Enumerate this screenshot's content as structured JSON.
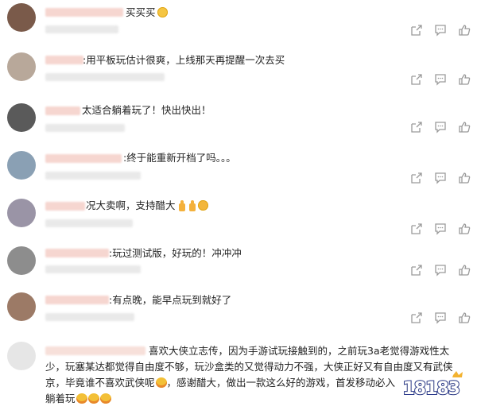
{
  "comments": [
    {
      "text": "买买买",
      "emoji": "grinning-face"
    },
    {
      "text": ":用平板玩估计很爽，上线那天再提醒一次去买"
    },
    {
      "text": "太适合躺着玩了！快出快出！"
    },
    {
      "text": ":终于能重新开档了吗。。。"
    },
    {
      "text": "况大卖啊，支持醋大",
      "emoji": "thumbs-up-thumbs-up-clapping"
    },
    {
      "text": ":玩过测试版，好玩的！冲冲冲"
    },
    {
      "text": ":有点晚，能早点玩到就好了"
    }
  ],
  "long_comment": {
    "line1": "喜欢大侠立志传，因为手游试玩接触到的，之前玩3a老觉得游戏性太",
    "line2": "少，玩塞某达都觉得自由度不够，玩沙盒类的又觉得动力不强，大侠正好又有自由度又有武侠",
    "line3a": "京，毕竟谁不喜欢武侠呢",
    "line3b": "，感谢醋大，做出一款这么好的游戏，首发移动必入",
    "line4": "躺着玩"
  },
  "actions": [
    "share-icon",
    "comment-icon",
    "like-icon"
  ],
  "watermark": {
    "text": "18183"
  }
}
